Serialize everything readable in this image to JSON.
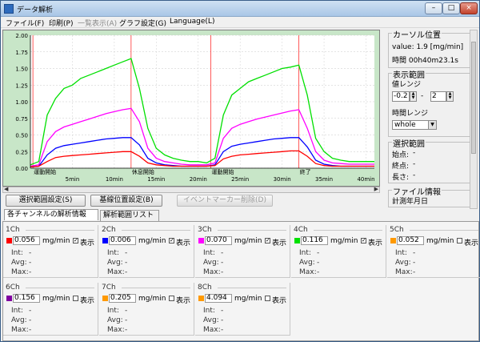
{
  "window": {
    "title": "データ解析"
  },
  "menu": [
    {
      "label": "ファイル(F)",
      "disabled": false
    },
    {
      "label": "印刷(P)",
      "disabled": false
    },
    {
      "label": "一覧表示(A)",
      "disabled": true
    },
    {
      "label": "グラフ設定(G)",
      "disabled": false
    },
    {
      "label": "Language(L)",
      "disabled": false
    }
  ],
  "chart_data": {
    "type": "line",
    "x_unit": "min",
    "xlim": [
      0,
      41
    ],
    "ylim": [
      0,
      2.0
    ],
    "y_ticks": [
      "2.00",
      "1.75",
      "1.50",
      "1.25",
      "1.00",
      "0.75",
      "0.50",
      "0.25",
      "0.00"
    ],
    "x_tick_labels": [
      "5min",
      "10min",
      "15min",
      "20min",
      "25min",
      "30min",
      "35min",
      "40min"
    ],
    "markers": [
      {
        "x": 0.3,
        "label": "運動開始"
      },
      {
        "x": 12,
        "label": "休息開始"
      },
      {
        "x": 21.5,
        "label": "運動開始"
      },
      {
        "x": 32,
        "label": "終了"
      }
    ],
    "series": [
      {
        "color": "#00e000",
        "x": [
          0,
          1,
          2,
          3,
          4,
          5,
          6,
          7,
          8,
          9,
          10,
          11,
          12,
          13,
          14,
          15,
          16,
          17,
          18,
          19,
          20,
          21,
          22,
          23,
          24,
          25,
          26,
          27,
          28,
          29,
          30,
          31,
          32,
          33,
          34,
          35,
          36,
          37,
          38,
          39,
          40,
          41
        ],
        "y": [
          0.05,
          0.1,
          0.8,
          1.05,
          1.2,
          1.25,
          1.35,
          1.4,
          1.45,
          1.5,
          1.55,
          1.6,
          1.65,
          1.2,
          0.6,
          0.3,
          0.2,
          0.15,
          0.12,
          0.1,
          0.1,
          0.08,
          0.15,
          0.8,
          1.1,
          1.2,
          1.3,
          1.35,
          1.4,
          1.45,
          1.5,
          1.52,
          1.55,
          1.1,
          0.45,
          0.25,
          0.15,
          0.12,
          0.1,
          0.1,
          0.1,
          0.1
        ]
      },
      {
        "color": "#ff00ff",
        "x": [
          0,
          1,
          2,
          3,
          4,
          5,
          6,
          7,
          8,
          9,
          10,
          11,
          12,
          13,
          14,
          15,
          16,
          17,
          18,
          19,
          20,
          21,
          22,
          23,
          24,
          25,
          26,
          27,
          28,
          29,
          30,
          31,
          32,
          33,
          34,
          35,
          36,
          37,
          38,
          39,
          40,
          41
        ],
        "y": [
          0.03,
          0.05,
          0.4,
          0.55,
          0.62,
          0.66,
          0.7,
          0.74,
          0.78,
          0.82,
          0.85,
          0.88,
          0.9,
          0.7,
          0.3,
          0.15,
          0.1,
          0.08,
          0.06,
          0.05,
          0.05,
          0.05,
          0.08,
          0.45,
          0.6,
          0.66,
          0.7,
          0.74,
          0.77,
          0.8,
          0.83,
          0.86,
          0.88,
          0.6,
          0.25,
          0.12,
          0.08,
          0.07,
          0.06,
          0.06,
          0.06,
          0.06
        ]
      },
      {
        "color": "#0000ff",
        "x": [
          0,
          1,
          2,
          3,
          4,
          5,
          6,
          7,
          8,
          9,
          10,
          11,
          12,
          13,
          14,
          15,
          16,
          17,
          18,
          19,
          20,
          21,
          22,
          23,
          24,
          25,
          26,
          27,
          28,
          29,
          30,
          31,
          32,
          33,
          34,
          35,
          36,
          37,
          38,
          39,
          40,
          41
        ],
        "y": [
          0.02,
          0.03,
          0.2,
          0.3,
          0.34,
          0.36,
          0.38,
          0.4,
          0.42,
          0.44,
          0.45,
          0.46,
          0.46,
          0.35,
          0.15,
          0.08,
          0.05,
          0.04,
          0.03,
          0.03,
          0.03,
          0.03,
          0.05,
          0.25,
          0.33,
          0.36,
          0.38,
          0.4,
          0.42,
          0.44,
          0.45,
          0.46,
          0.46,
          0.32,
          0.12,
          0.06,
          0.04,
          0.03,
          0.03,
          0.03,
          0.03,
          0.03
        ]
      },
      {
        "color": "#ff0000",
        "x": [
          0,
          1,
          2,
          3,
          4,
          5,
          6,
          7,
          8,
          9,
          10,
          11,
          12,
          13,
          14,
          15,
          16,
          17,
          18,
          19,
          20,
          21,
          22,
          23,
          24,
          25,
          26,
          27,
          28,
          29,
          30,
          31,
          32,
          33,
          34,
          35,
          36,
          37,
          38,
          39,
          40,
          41
        ],
        "y": [
          0.02,
          0.03,
          0.1,
          0.16,
          0.18,
          0.19,
          0.2,
          0.21,
          0.22,
          0.23,
          0.24,
          0.25,
          0.25,
          0.18,
          0.08,
          0.05,
          0.04,
          0.03,
          0.03,
          0.03,
          0.03,
          0.03,
          0.04,
          0.14,
          0.18,
          0.2,
          0.21,
          0.22,
          0.23,
          0.24,
          0.25,
          0.26,
          0.26,
          0.18,
          0.07,
          0.04,
          0.03,
          0.03,
          0.03,
          0.03,
          0.03,
          0.03
        ]
      }
    ]
  },
  "buttons": {
    "select_range": "選択範囲設定(S)",
    "baseline": "基線位置設定(B)",
    "delete_marker": "イベントマーカー削除(D)"
  },
  "tabs": [
    {
      "label": "各チャンネルの解析情報",
      "active": true
    },
    {
      "label": "解析範囲リスト",
      "active": false
    }
  ],
  "channels": [
    {
      "title": "1Ch",
      "color": "#ff0000",
      "value": "0.056",
      "unit": "mg/min",
      "show": true,
      "show_label": "表示",
      "int_label": "Int:",
      "int": "-",
      "avg_label": "Avg:",
      "avg": "-",
      "max_label": "Max:",
      "max": "-"
    },
    {
      "title": "2Ch",
      "color": "#0000ff",
      "value": "0.006",
      "unit": "mg/min",
      "show": true,
      "show_label": "表示",
      "int_label": "Int:",
      "int": "-",
      "avg_label": "Avg:",
      "avg": "-",
      "max_label": "Max:",
      "max": "-"
    },
    {
      "title": "3Ch",
      "color": "#ff00ff",
      "value": "0.070",
      "unit": "mg/min",
      "show": true,
      "show_label": "表示",
      "int_label": "Int:",
      "int": "-",
      "avg_label": "Avg:",
      "avg": "-",
      "max_label": "Max:",
      "max": "-"
    },
    {
      "title": "4Ch",
      "color": "#00e000",
      "value": "0.116",
      "unit": "mg/min",
      "show": true,
      "show_label": "表示",
      "int_label": "Int:",
      "int": "-",
      "avg_label": "Avg:",
      "avg": "-",
      "max_label": "Max:",
      "max": "-"
    },
    {
      "title": "5Ch",
      "color": "#ff9900",
      "value": "0.052",
      "unit": "mg/min",
      "show": false,
      "show_label": "表示",
      "int_label": "Int:",
      "int": "-",
      "avg_label": "Avg:",
      "avg": "-",
      "max_label": "Max:",
      "max": "-"
    },
    {
      "title": "6Ch",
      "color": "#8000a0",
      "value": "0.156",
      "unit": "mg/min",
      "show": false,
      "show_label": "表示",
      "int_label": "Int:",
      "int": "-",
      "avg_label": "Avg:",
      "avg": "-",
      "max_label": "Max:",
      "max": "-"
    },
    {
      "title": "7Ch",
      "color": "#ff9900",
      "value": "0.205",
      "unit": "mg/min",
      "show": false,
      "show_label": "表示",
      "int_label": "Int:",
      "int": "-",
      "avg_label": "Avg:",
      "avg": "-",
      "max_label": "Max:",
      "max": "-"
    },
    {
      "title": "8Ch",
      "color": "#ff9900",
      "value": "4.094",
      "unit": "mg/min",
      "show": false,
      "show_label": "表示",
      "int_label": "Int:",
      "int": "-",
      "avg_label": "Avg:",
      "avg": "-",
      "max_label": "Max:",
      "max": "-"
    }
  ],
  "side": {
    "cursor_title": "カーソル位置",
    "cursor_value": "value: 1.9 [mg/min]",
    "cursor_time": "時間 00h40m23.1s",
    "range_title": "表示範囲",
    "value_range_label": "値レンジ",
    "range_min": "-0.2",
    "range_dash": "-",
    "range_max": "2",
    "time_range_label": "時間レンジ",
    "time_range_value": "whole",
    "select_title": "選択範囲",
    "start_label": "始点:",
    "end_label": "終点:",
    "length_label": "長さ:",
    "start_value": "-",
    "end_value": "-",
    "length_value": "-",
    "file_title": "ファイル情報",
    "date_label": "計測年月日"
  }
}
